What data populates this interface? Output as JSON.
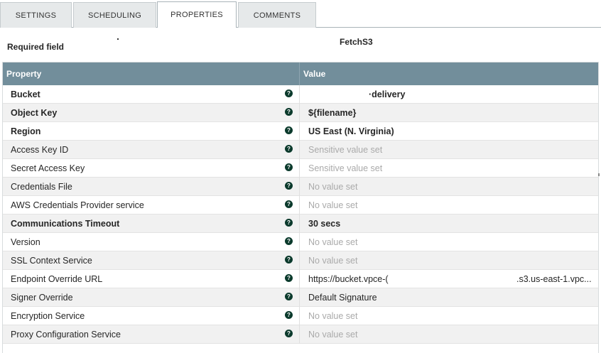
{
  "tabs": [
    {
      "label": "SETTINGS"
    },
    {
      "label": "SCHEDULING"
    },
    {
      "label": "PROPERTIES"
    },
    {
      "label": "COMMENTS"
    }
  ],
  "required_field": "Required field",
  "processor_name": "FetchS3",
  "grid": {
    "header_property": "Property",
    "header_value": "Value",
    "rows": [
      {
        "property": "Bucket",
        "value": "·delivery"
      },
      {
        "property": "Object Key",
        "value": "${filename}"
      },
      {
        "property": "Region",
        "value": "US East (N. Virginia)"
      },
      {
        "property": "Access Key ID",
        "value": "Sensitive value set"
      },
      {
        "property": "Secret Access Key",
        "value": "Sensitive value set"
      },
      {
        "property": "Credentials File",
        "value": "No value set"
      },
      {
        "property": "AWS Credentials Provider service",
        "value": "No value set"
      },
      {
        "property": "Communications Timeout",
        "value": "30 secs"
      },
      {
        "property": "Version",
        "value": "No value set"
      },
      {
        "property": "SSL Context Service",
        "value": "No value set"
      },
      {
        "property": "Endpoint Override URL",
        "value": "https://bucket.vpce-(",
        "value_suffix": ".s3.us-east-1.vpc..."
      },
      {
        "property": "Signer Override",
        "value": "Default Signature"
      },
      {
        "property": "Encryption Service",
        "value": "No value set"
      },
      {
        "property": "Proxy Configuration Service",
        "value": "No value set"
      }
    ]
  },
  "icons": {
    "help": "help-circle-icon"
  },
  "colors": {
    "header_bg": "#728e9b",
    "help_icon": "#0b3a2c"
  }
}
